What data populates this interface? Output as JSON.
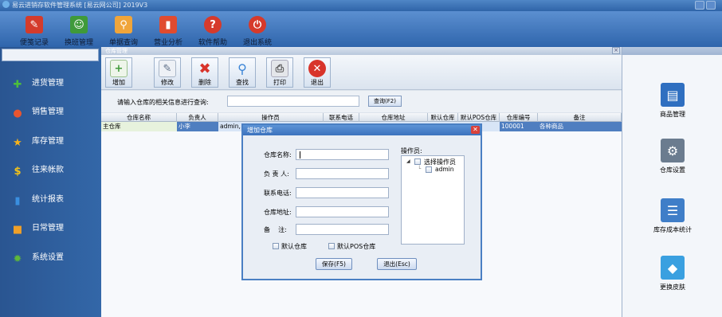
{
  "window": {
    "title": "易云进销存软件管理系统 [易云网公司] 2019V3"
  },
  "main_toolbar": [
    {
      "label": "便笺记录",
      "icon": "notepad-icon",
      "color": "#d43b2b"
    },
    {
      "label": "换班管理",
      "icon": "users-icon",
      "color": "#3f9a3a"
    },
    {
      "label": "单据查询",
      "icon": "magnifier-icon",
      "color": "#f0a53a"
    },
    {
      "label": "营业分析",
      "icon": "bar-chart-icon",
      "color": "#e04b2f"
    },
    {
      "label": "软件帮助",
      "icon": "help-icon",
      "color": "#d63a2b"
    },
    {
      "label": "退出系统",
      "icon": "power-icon",
      "color": "#d63a2b"
    }
  ],
  "sidebar": {
    "items": [
      {
        "label": "进货管理",
        "icon": "plus-icon",
        "color": "#4cbf3b"
      },
      {
        "label": "销售管理",
        "icon": "pie-chart-icon",
        "color": "#e9552f"
      },
      {
        "label": "库存管理",
        "icon": "star-icon",
        "color": "#f7b21b"
      },
      {
        "label": "往来帐款",
        "icon": "dollar-icon",
        "color": "#f2c21a"
      },
      {
        "label": "统计报表",
        "icon": "bar-chart-icon",
        "color": "#3a8fe0"
      },
      {
        "label": "日常管理",
        "icon": "folder-icon",
        "color": "#f0a028"
      },
      {
        "label": "系统设置",
        "icon": "gear-icon",
        "color": "#5fb83a"
      }
    ]
  },
  "warehouse": {
    "panel_title": "仓库管理",
    "toolbar": [
      {
        "label": "增加",
        "icon": "add-document-icon",
        "color": "#3f9a3a"
      },
      {
        "label": "修改",
        "icon": "edit-document-icon",
        "color": "#7f8fa8"
      },
      {
        "label": "删除",
        "icon": "delete-x-icon",
        "color": "#d8342b"
      },
      {
        "label": "查找",
        "icon": "magnifier-icon",
        "color": "#3a84d6"
      },
      {
        "label": "打印",
        "icon": "printer-icon",
        "color": "#8a8f98"
      },
      {
        "label": "退出",
        "icon": "exit-x-icon",
        "color": "#d8342b"
      }
    ],
    "search": {
      "label": "请输入仓库的相关信息进行查询:",
      "value": "",
      "button": "查询(F2)"
    },
    "columns": [
      "仓库名称",
      "负责人",
      "操作员",
      "联系电话",
      "仓库地址",
      "默认仓库",
      "默认POS仓库",
      "仓库编号",
      "备注"
    ],
    "rows": [
      {
        "name": "主仓库",
        "manager": "小李",
        "operator": "admin,",
        "phone": "",
        "address": "",
        "default": "",
        "pos_default": "",
        "code": "100001",
        "note": "各种商品"
      }
    ]
  },
  "dialog": {
    "title": "增加仓库",
    "fields": {
      "name": {
        "label": "仓库名称:",
        "value": ""
      },
      "manager": {
        "label": "负 责 人:",
        "value": ""
      },
      "phone": {
        "label": "联系电话:",
        "value": ""
      },
      "address": {
        "label": "仓库地址:",
        "value": ""
      },
      "note": {
        "label": "备    注:",
        "value": ""
      }
    },
    "checkboxes": {
      "default_warehouse": "默认仓库",
      "default_pos": "默认POS仓库"
    },
    "operators": {
      "label": "操作员:",
      "root": "选择操作员",
      "children": [
        "admin"
      ]
    },
    "save_button": "保存(F5)",
    "exit_button": "退出(Esc)"
  },
  "right_panel": [
    {
      "label": "商品管理",
      "icon": "book-icon",
      "color": "#2f6fc0"
    },
    {
      "label": "仓库设置",
      "icon": "warehouse-gear-icon",
      "color": "#6b7c8f"
    },
    {
      "label": "库存成本统计",
      "icon": "list-document-icon",
      "color": "#3f7ec8"
    },
    {
      "label": "更换皮肤",
      "icon": "cubes-icon",
      "color": "#3aa0e0"
    }
  ]
}
